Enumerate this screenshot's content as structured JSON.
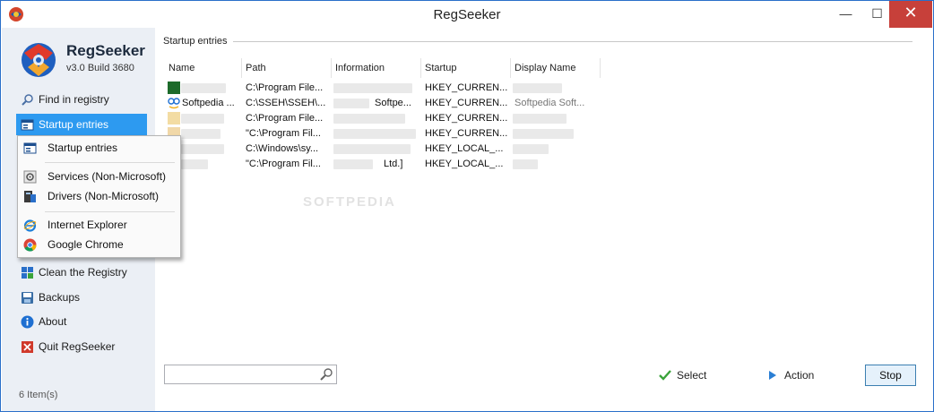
{
  "window": {
    "title": "RegSeeker",
    "minimize_glyph": "—",
    "maximize_glyph": "☐",
    "close_glyph": "✕",
    "app_icon": "regseeker-globe-icon"
  },
  "brand": {
    "name": "RegSeeker",
    "version": "v3.0 Build 3680"
  },
  "sidebar": {
    "items": [
      {
        "label": "Find in registry",
        "icon": "magnifier-icon"
      },
      {
        "label": "Startup entries",
        "icon": "startup-window-icon",
        "active": true
      },
      {
        "label": "Clean the Registry",
        "icon": "registry-clean-icon"
      },
      {
        "label": "Backups",
        "icon": "backup-disk-icon"
      },
      {
        "label": "About",
        "icon": "info-icon"
      },
      {
        "label": "Quit RegSeeker",
        "icon": "quit-x-icon"
      }
    ],
    "status": "6 Item(s)"
  },
  "dropdown": {
    "items": [
      {
        "label": "Startup entries",
        "icon": "startup-window-icon"
      },
      {
        "label": "Services (Non-Microsoft)",
        "icon": "services-gear-icon"
      },
      {
        "label": "Drivers (Non-Microsoft)",
        "icon": "drivers-icon"
      },
      {
        "label": "Internet Explorer",
        "icon": "internet-explorer-icon"
      },
      {
        "label": "Google Chrome",
        "icon": "google-chrome-icon"
      }
    ]
  },
  "main": {
    "group_title": "Startup entries",
    "columns": [
      "Name",
      "Path",
      "Information",
      "Startup",
      "Display Name"
    ],
    "rows": [
      {
        "name": "",
        "path": "C:\\Program File...",
        "information": "",
        "startup": "HKEY_CURREN...",
        "display_name": ""
      },
      {
        "name": "Softpedia ...",
        "path": "C:\\SSEH\\SSEH\\...",
        "information": "Softpe...",
        "startup": "HKEY_CURREN...",
        "display_name": "Softpedia Soft..."
      },
      {
        "name": "",
        "path": "C:\\Program File...",
        "information": "",
        "startup": "HKEY_CURREN...",
        "display_name": ""
      },
      {
        "name": "",
        "path": "\"C:\\Program Fil...",
        "information": "",
        "startup": "HKEY_CURREN...",
        "display_name": ""
      },
      {
        "name": "",
        "path": "C:\\Windows\\sy...",
        "information": "",
        "startup": "HKEY_LOCAL_...",
        "display_name": ""
      },
      {
        "name": "",
        "path": "\"C:\\Program Fil...",
        "information": "Ltd.]",
        "startup": "HKEY_LOCAL_...",
        "display_name": ""
      }
    ],
    "watermark": "SOFTPEDIA",
    "search": {
      "value": "",
      "placeholder": ""
    },
    "actions": {
      "select_label": "Select",
      "action_label": "Action",
      "stop_label": "Stop"
    }
  },
  "colors": {
    "accent": "#2d9af0",
    "sidebar_bg": "#ebeff5",
    "close_red": "#c7403a",
    "select_green": "#3aa33a",
    "action_blue": "#2b7fd4"
  }
}
